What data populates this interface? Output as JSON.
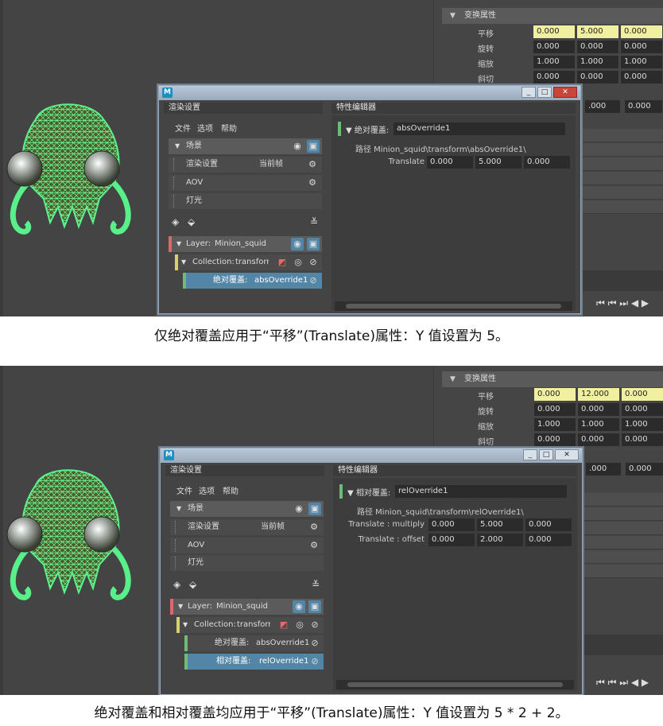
{
  "panels": [
    {
      "attr_editor": {
        "section": "变换属性",
        "rows": [
          {
            "label": "平移",
            "values": [
              "0.000",
              "5.000",
              "0.000"
            ],
            "highlight": true
          },
          {
            "label": "旋转",
            "values": [
              "0.000",
              "0.000",
              "0.000"
            ],
            "highlight": false
          },
          {
            "label": "缩放",
            "values": [
              "1.000",
              "1.000",
              "1.000"
            ],
            "highlight": false
          },
          {
            "label": "斜切",
            "values": [
              "0.000",
              "0.000",
              "0.000"
            ],
            "highlight": false
          }
        ],
        "extra_values": [
          ".000",
          "0.000"
        ]
      },
      "window": {
        "left_tab": "渲染设置",
        "right_tab": "特性编辑器",
        "menu": [
          "文件",
          "选项",
          "帮助"
        ],
        "scene_label": "场景",
        "render_settings_label": "渲染设置",
        "current_frame_label": "当前帧",
        "aov_label": "AOV",
        "lights_label": "灯光",
        "layer_label": "Layer:",
        "layer_name": "Minion_squid",
        "collection_label": "Collection:",
        "collection_name": "transform",
        "overrides": [
          {
            "type_label": "绝对覆盖:",
            "name": "absOverride1",
            "selected": true,
            "color": "#6fba77"
          }
        ],
        "editor": {
          "override_type": "绝对覆盖:",
          "override_name": "absOverride1",
          "path": "路径 Minion_squid\\transform\\absOverride1\\",
          "params": [
            {
              "label": "Translate",
              "values": [
                "0.000",
                "5.000",
                "0.000"
              ]
            }
          ]
        }
      },
      "caption": "仅绝对覆盖应用于“平移”(Translate)属性：Y 值设置为 5。"
    },
    {
      "attr_editor": {
        "section": "变换属性",
        "rows": [
          {
            "label": "平移",
            "values": [
              "0.000",
              "12.000",
              "0.000"
            ],
            "highlight": true
          },
          {
            "label": "旋转",
            "values": [
              "0.000",
              "0.000",
              "0.000"
            ],
            "highlight": false
          },
          {
            "label": "缩放",
            "values": [
              "1.000",
              "1.000",
              "1.000"
            ],
            "highlight": false
          },
          {
            "label": "斜切",
            "values": [
              "0.000",
              "0.000",
              "0.000"
            ],
            "highlight": false
          }
        ],
        "extra_values": [
          ".000",
          "0.000"
        ]
      },
      "window": {
        "left_tab": "渲染设置",
        "right_tab": "特性编辑器",
        "menu": [
          "文件",
          "选项",
          "帮助"
        ],
        "scene_label": "场景",
        "render_settings_label": "渲染设置",
        "current_frame_label": "当前帧",
        "aov_label": "AOV",
        "lights_label": "灯光",
        "layer_label": "Layer:",
        "layer_name": "Minion_squid",
        "collection_label": "Collection:",
        "collection_name": "transform",
        "overrides": [
          {
            "type_label": "绝对覆盖:",
            "name": "absOverride1",
            "selected": false,
            "color": "#6fba77"
          },
          {
            "type_label": "相对覆盖:",
            "name": "relOverride1",
            "selected": true,
            "color": "#6fba77"
          }
        ],
        "editor": {
          "override_type": "相对覆盖:",
          "override_name": "relOverride1",
          "path": "路径 Minion_squid\\transform\\relOverride1\\",
          "params": [
            {
              "label": "Translate : multiply",
              "values": [
                "0.000",
                "5.000",
                "0.000"
              ]
            },
            {
              "label": "Translate : offset",
              "values": [
                "0.000",
                "2.000",
                "0.000"
              ]
            }
          ]
        }
      },
      "caption": "绝对覆盖和相对覆盖均应用于“平移”(Translate)属性：Y 值设置为 5 * 2 + 2。"
    }
  ],
  "colors": {
    "layer": "#d86a6a",
    "collection": "#d8cf6a",
    "override": "#6fba77",
    "selection": "#5285a6",
    "keyed_field": "#f0f0a0"
  },
  "icons": [
    "eye-icon",
    "render-icon",
    "gear-icon",
    "add-collection-icon",
    "add-layer-icon",
    "clear-icon",
    "solo-icon",
    "disable-icon",
    "playback-icons"
  ]
}
